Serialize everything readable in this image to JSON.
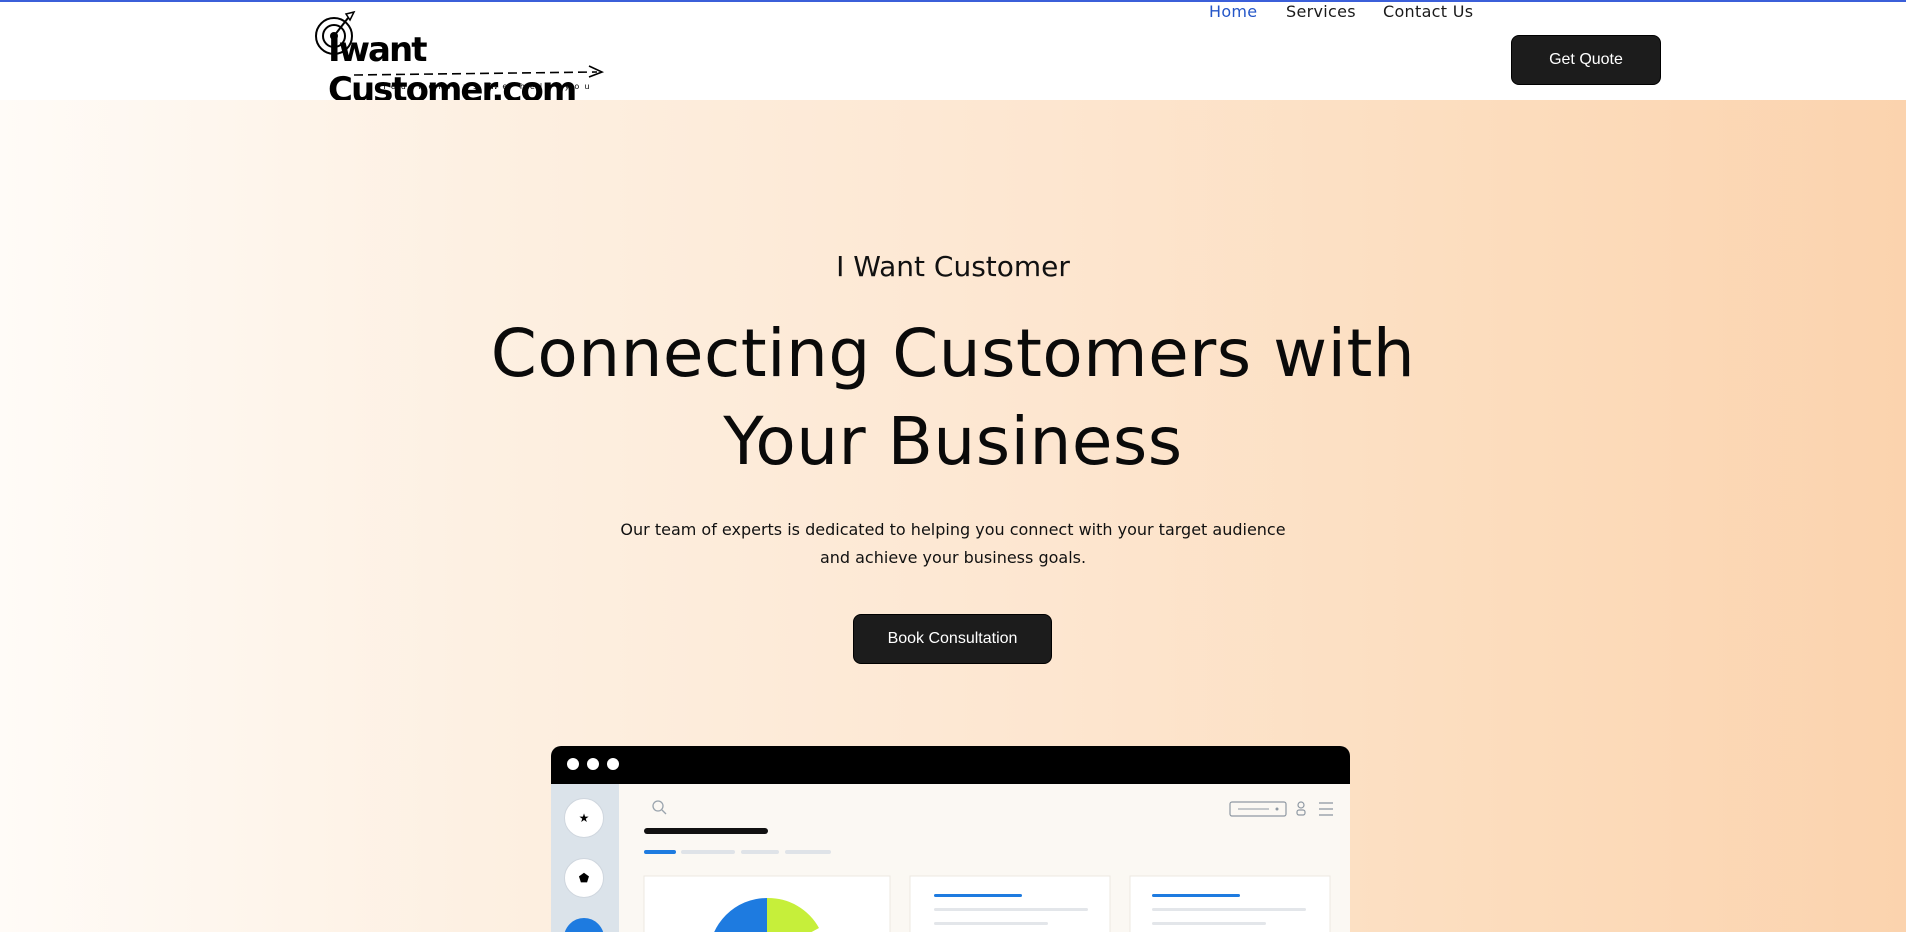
{
  "brand": {
    "logo_text": "Iwant Customer.com",
    "tagline": "You help us We help you"
  },
  "nav": {
    "items": [
      {
        "label": "Home",
        "active": true
      },
      {
        "label": "Services",
        "active": false
      },
      {
        "label": "Contact Us",
        "active": false
      }
    ],
    "cta_label": "Get Quote"
  },
  "hero": {
    "eyebrow": "I Want Customer",
    "headline_line1": "Connecting Customers with",
    "headline_line2": "Your Business",
    "subtext_line1": "Our team of experts is dedicated to helping you connect with your target audience",
    "subtext_line2": "and achieve your business goals.",
    "cta_label": "Book Consultation"
  },
  "mockup": {
    "sidebar_icons": [
      "star-icon",
      "pentagon-icon",
      "circle-icon"
    ],
    "toolbar_icons": [
      "search-icon",
      "dropdown-icon",
      "user-icon",
      "menu-icon"
    ]
  },
  "colors": {
    "accent_blue": "#2456c8",
    "button_dark": "#1c1c1c",
    "chart_blue": "#1e7be0",
    "chart_lime": "#c6ef3a"
  }
}
